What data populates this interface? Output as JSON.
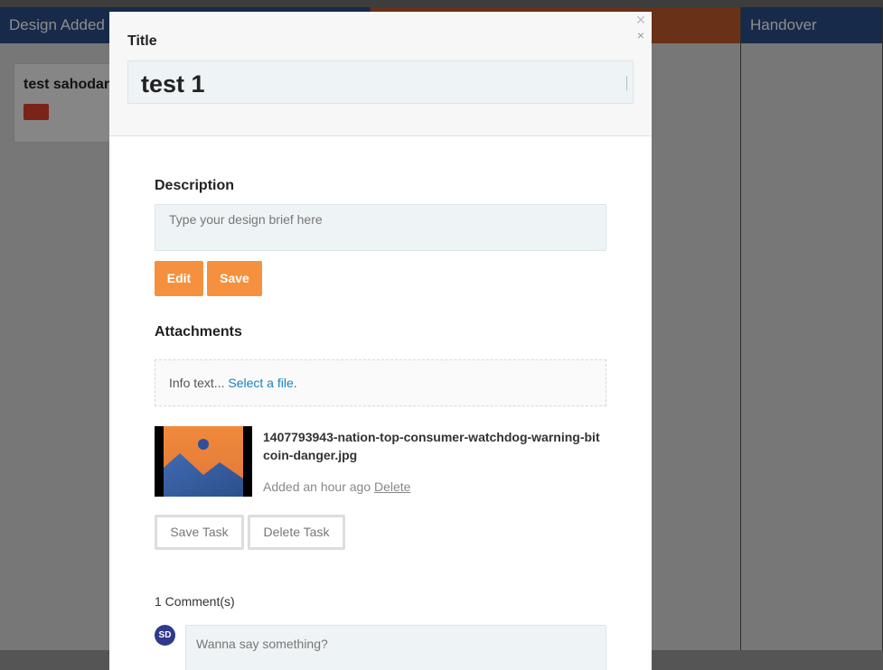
{
  "board": {
    "columns": [
      {
        "title": "Design Added",
        "color": "#2b4d88"
      },
      {
        "title": "",
        "color": "#c0592a"
      },
      {
        "title": "Handover",
        "color": "#2b4d88"
      }
    ],
    "card": {
      "title": "test sahodar"
    }
  },
  "modal": {
    "close_icon": "×",
    "title_label": "Title",
    "title_value": "test 1",
    "description_label": "Description",
    "description_placeholder": "Type your design brief here",
    "edit_label": "Edit",
    "save_label": "Save",
    "attachments_label": "Attachments",
    "dropzone": {
      "info": "Info text...",
      "link": "Select a file",
      "suffix": "."
    },
    "attachment": {
      "file_name": "1407793943-nation-top-consumer-watchdog-warning-bitcoin-danger.jpg",
      "meta": "Added an hour ago",
      "delete_label": "Delete"
    },
    "save_task_label": "Save Task",
    "delete_task_label": "Delete Task",
    "comments_count": "1 Comment(s)",
    "avatar_initials": "SD",
    "comment_placeholder": "Wanna say something?"
  },
  "colors": {
    "accent_orange": "#f5913e",
    "link_blue": "#1a7fc1",
    "avatar_navy": "#2e3a8c"
  }
}
